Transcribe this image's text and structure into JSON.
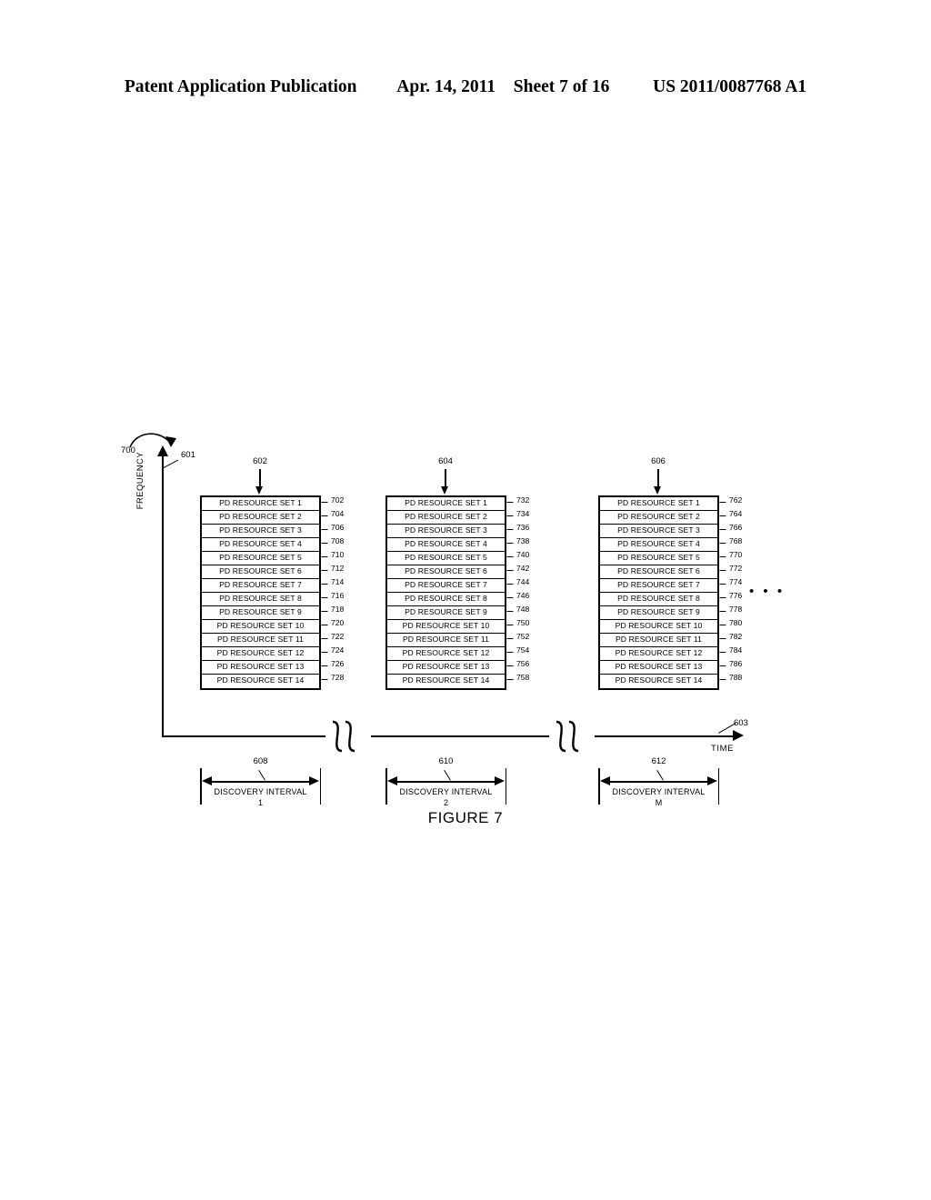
{
  "header": {
    "publication": "Patent Application Publication",
    "date": "Apr. 14, 2011",
    "sheet": "Sheet 7 of 16",
    "patent_number": "US 2011/0087768 A1"
  },
  "figure": {
    "caption": "FIGURE 7",
    "diagram_ref": "700",
    "axes": {
      "y_label": "FREQUENCY",
      "y_ref": "601",
      "x_label": "TIME",
      "x_ref": "603"
    },
    "ellipsis": "• • •",
    "columns": [
      {
        "ref": "602",
        "rows": [
          {
            "label": "PD RESOURCE SET 1",
            "ref": "702"
          },
          {
            "label": "PD RESOURCE SET 2",
            "ref": "704"
          },
          {
            "label": "PD RESOURCE SET 3",
            "ref": "706"
          },
          {
            "label": "PD RESOURCE SET 4",
            "ref": "708"
          },
          {
            "label": "PD RESOURCE SET 5",
            "ref": "710"
          },
          {
            "label": "PD RESOURCE SET 6",
            "ref": "712"
          },
          {
            "label": "PD RESOURCE SET 7",
            "ref": "714"
          },
          {
            "label": "PD RESOURCE SET 8",
            "ref": "716"
          },
          {
            "label": "PD RESOURCE SET 9",
            "ref": "718"
          },
          {
            "label": "PD RESOURCE SET 10",
            "ref": "720"
          },
          {
            "label": "PD RESOURCE SET 11",
            "ref": "722"
          },
          {
            "label": "PD RESOURCE SET 12",
            "ref": "724"
          },
          {
            "label": "PD RESOURCE SET 13",
            "ref": "726"
          },
          {
            "label": "PD RESOURCE SET 14",
            "ref": "728"
          }
        ]
      },
      {
        "ref": "604",
        "rows": [
          {
            "label": "PD RESOURCE SET 1",
            "ref": "732"
          },
          {
            "label": "PD RESOURCE SET 2",
            "ref": "734"
          },
          {
            "label": "PD RESOURCE SET 3",
            "ref": "736"
          },
          {
            "label": "PD RESOURCE SET 4",
            "ref": "738"
          },
          {
            "label": "PD RESOURCE SET 5",
            "ref": "740"
          },
          {
            "label": "PD RESOURCE SET 6",
            "ref": "742"
          },
          {
            "label": "PD RESOURCE SET 7",
            "ref": "744"
          },
          {
            "label": "PD RESOURCE SET 8",
            "ref": "746"
          },
          {
            "label": "PD RESOURCE SET 9",
            "ref": "748"
          },
          {
            "label": "PD RESOURCE SET 10",
            "ref": "750"
          },
          {
            "label": "PD RESOURCE SET 11",
            "ref": "752"
          },
          {
            "label": "PD RESOURCE SET 12",
            "ref": "754"
          },
          {
            "label": "PD RESOURCE SET 13",
            "ref": "756"
          },
          {
            "label": "PD RESOURCE SET 14",
            "ref": "758"
          }
        ]
      },
      {
        "ref": "606",
        "rows": [
          {
            "label": "PD RESOURCE SET 1",
            "ref": "762"
          },
          {
            "label": "PD RESOURCE SET 2",
            "ref": "764"
          },
          {
            "label": "PD RESOURCE SET 3",
            "ref": "766"
          },
          {
            "label": "PD RESOURCE SET 4",
            "ref": "768"
          },
          {
            "label": "PD RESOURCE SET 5",
            "ref": "770"
          },
          {
            "label": "PD RESOURCE SET 6",
            "ref": "772"
          },
          {
            "label": "PD RESOURCE SET 7",
            "ref": "774"
          },
          {
            "label": "PD RESOURCE SET 8",
            "ref": "776"
          },
          {
            "label": "PD RESOURCE SET 9",
            "ref": "778"
          },
          {
            "label": "PD RESOURCE SET 10",
            "ref": "780"
          },
          {
            "label": "PD RESOURCE SET 11",
            "ref": "782"
          },
          {
            "label": "PD RESOURCE SET 12",
            "ref": "784"
          },
          {
            "label": "PD RESOURCE SET 13",
            "ref": "786"
          },
          {
            "label": "PD RESOURCE SET 14",
            "ref": "788"
          }
        ]
      }
    ],
    "intervals": [
      {
        "ref": "608",
        "label": "DISCOVERY INTERVAL",
        "index": "1"
      },
      {
        "ref": "610",
        "label": "DISCOVERY INTERVAL",
        "index": "2"
      },
      {
        "ref": "612",
        "label": "DISCOVERY INTERVAL",
        "index": "M"
      }
    ]
  }
}
